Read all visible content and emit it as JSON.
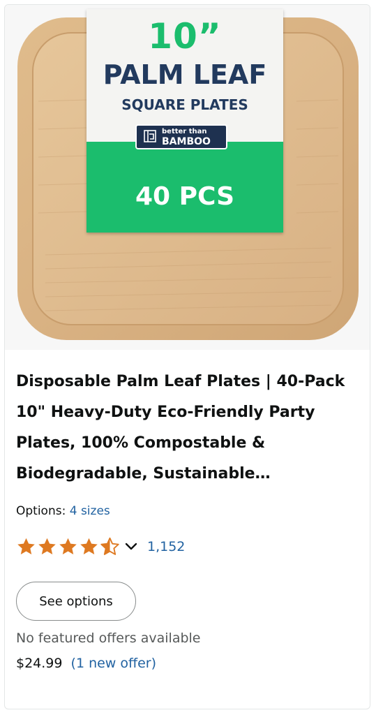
{
  "product_image": {
    "alt": "Palm leaf square plate product image",
    "package_label": {
      "size": "10”",
      "name": "PALM LEAF",
      "subtitle": "SQUARE PLATES",
      "brand_line1": "better than",
      "brand_line2": "BAMBOO",
      "count": "40 PCS"
    }
  },
  "title": "Disposable Palm Leaf Plates | 40-Pack 10\" Heavy-Duty Eco-Friendly Party Plates, 100% Compostable & Biodegradable, Sustainable…",
  "options": {
    "label": "Options:",
    "value": "4 sizes"
  },
  "rating": {
    "stars": 4.5,
    "count": "1,152",
    "star_color": "#de7921"
  },
  "see_options_label": "See options",
  "no_offers_text": "No featured offers available",
  "price": "$24.99",
  "offer_link": "(1 new offer)",
  "colors": {
    "link": "#2162a1",
    "label_green": "#1bbd6d",
    "label_navy": "#223a5e"
  }
}
